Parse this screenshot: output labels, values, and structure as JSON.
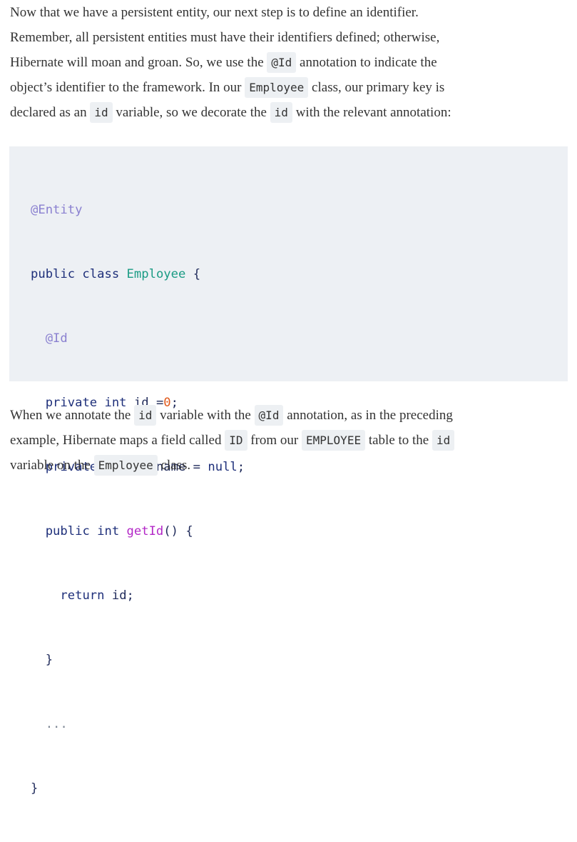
{
  "intro": {
    "line1": [
      "Now that we have a persistent entity, our next step is to define an identifier."
    ],
    "line2": [
      "Remember, all persistent entities must have their identifiers defined; otherwise,"
    ],
    "line3": [
      "Hibernate will moan and groan. So, we use the ",
      "@Id",
      " annotation to indicate the"
    ],
    "line4": [
      "object’s identifier to the framework. In our ",
      "Employee",
      " class, our primary key is"
    ],
    "line5": [
      "declared as an ",
      "id",
      " variable, so we decorate the ",
      "id",
      " with the relevant annotation:"
    ]
  },
  "code": {
    "l1": "@Entity",
    "l2_kw": "public class",
    "l2_cls": "Employee",
    "l2_tail": " {",
    "l3": "@Id",
    "l4_kw": "private int",
    "l4_name": " id ",
    "l4_op": "=",
    "l4_num": "0",
    "l4_tail": ";",
    "l5_kw": "private",
    "l5_type": " String",
    "l5_name": " name ",
    "l5_op": "=",
    "l5_null": " null",
    "l5_tail": ";",
    "l6_kw": "public int",
    "l6_fn": " getId",
    "l6_tail": "() {",
    "l7_kw": "return",
    "l7_tail": " id;",
    "l8": "}",
    "l9": "...",
    "l10": "}"
  },
  "outro": {
    "line1": [
      "When we annotate the ",
      "id",
      " variable with the ",
      "@Id",
      " annotation, as in the preceding"
    ],
    "line2": [
      "example, Hibernate maps a field called ",
      "ID",
      " from our ",
      "EMPLOYEE",
      " table to the ",
      "id"
    ],
    "line3": [
      "variable on the ",
      "Employee",
      " class."
    ]
  },
  "colors": {
    "code_background": "#edf0f4",
    "inline_code_background": "#edf0f3",
    "annotation": "#8a80d0",
    "keyword": "#1e2f7a",
    "class_name": "#1a9b84",
    "method_name": "#b327c7",
    "number": "#e0591b",
    "body_text": "#333333"
  }
}
